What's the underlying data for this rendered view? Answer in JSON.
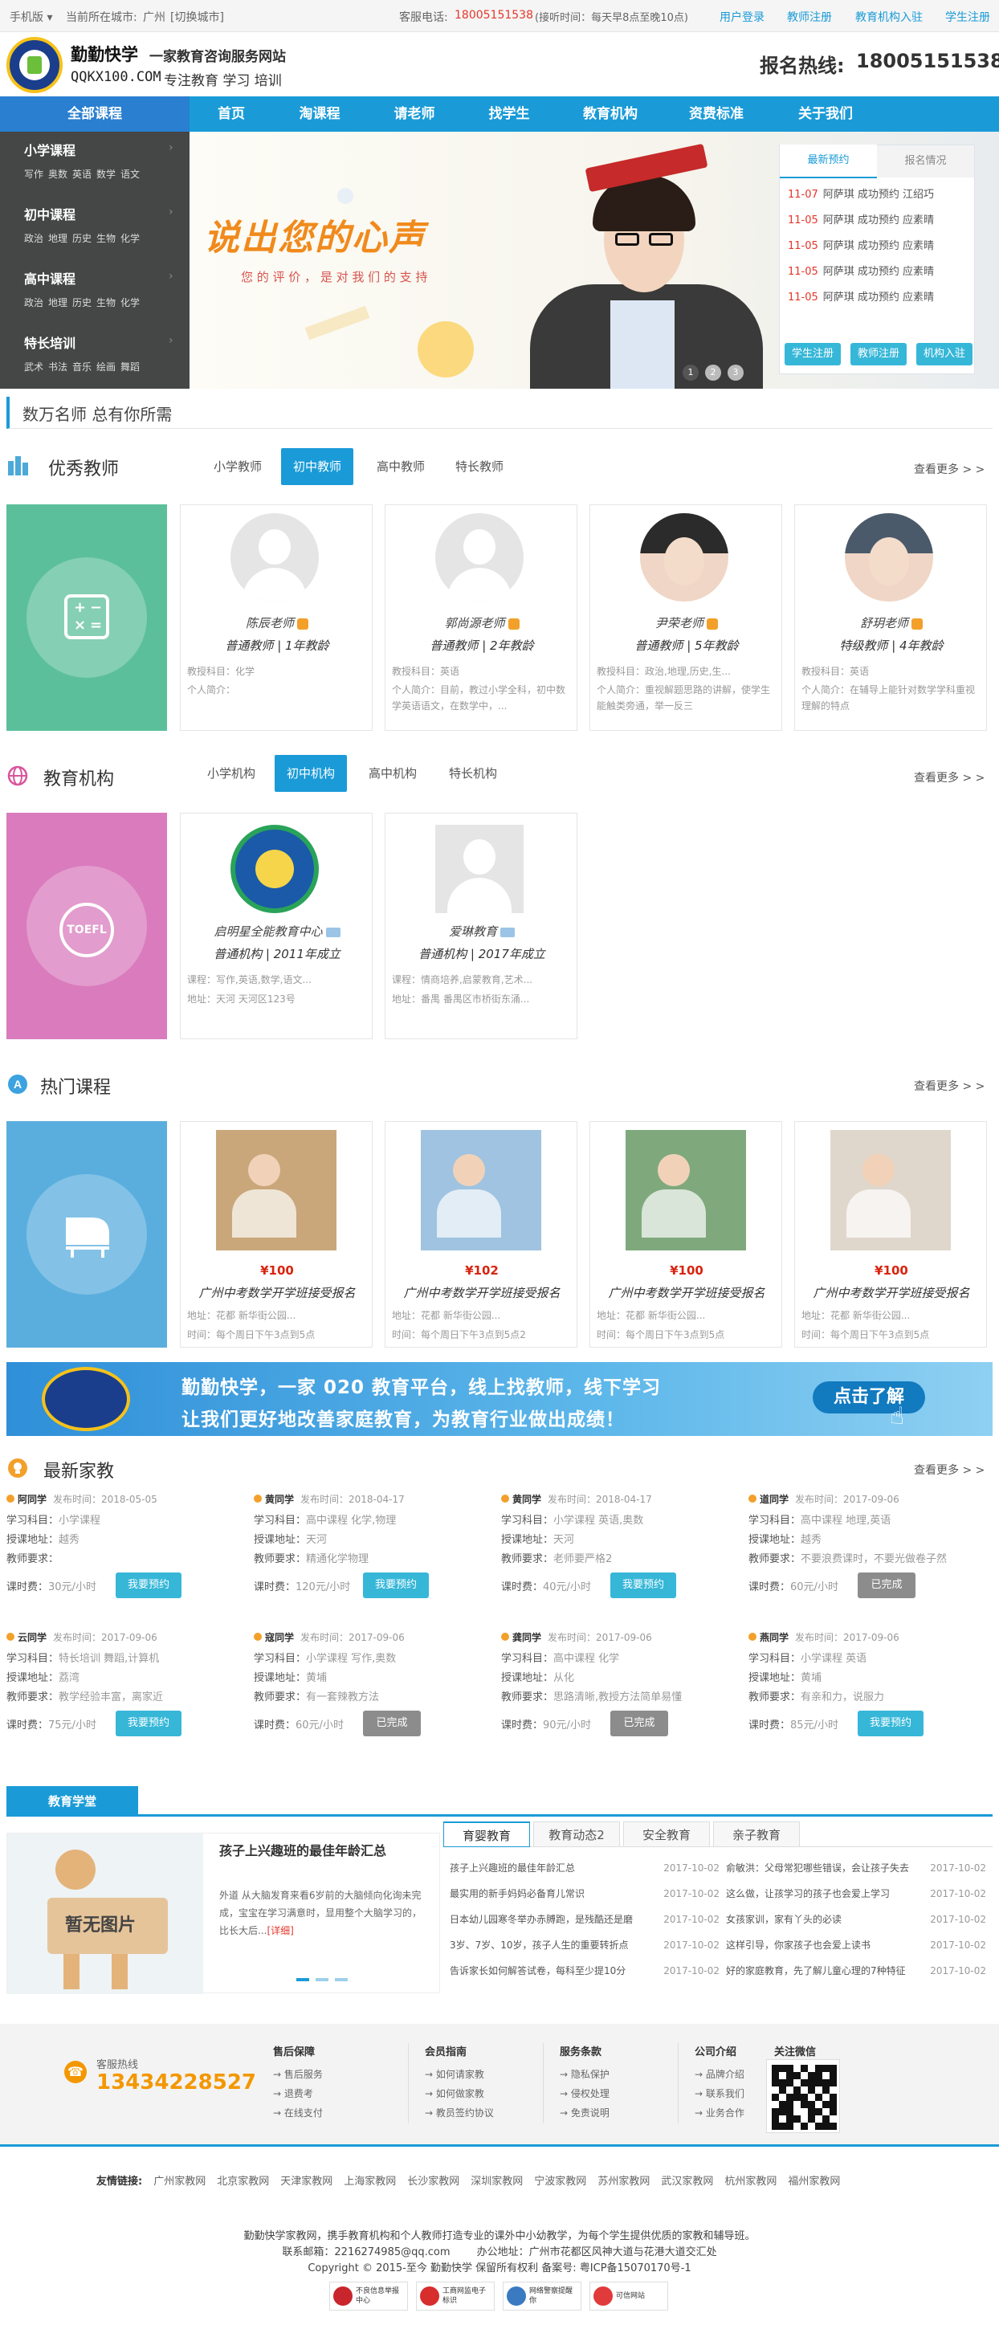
{
  "topbar": {
    "mobile": "手机版",
    "city_label": "当前所在城市:",
    "city": "广州",
    "switch_city": "[切换城市]",
    "hotline_label": "客服电话:",
    "hotline": "18005151538",
    "hours": "(接听时间：每天早8点至晚10点)",
    "login": "用户登录",
    "teacher_reg": "教师注册",
    "org_reg": "教育机构入驻",
    "student_reg": "学生注册"
  },
  "header": {
    "brand": "勤勤快学",
    "slogan1": "一家教育咨询服务网站",
    "domain": "QQKX100.COM",
    "slogan2": "专注教育 学习 培训",
    "hotline_label": "报名热线:",
    "hotline": "18005151538"
  },
  "nav": [
    "全部课程",
    "首页",
    "淘课程",
    "请老师",
    "找学生",
    "教育机构",
    "资费标准",
    "关于我们"
  ],
  "sidebar": [
    {
      "title": "小学课程",
      "subs": [
        "写作",
        "奥数",
        "英语",
        "数学",
        "语文"
      ]
    },
    {
      "title": "初中课程",
      "subs": [
        "政治",
        "地理",
        "历史",
        "生物",
        "化学"
      ]
    },
    {
      "title": "高中课程",
      "subs": [
        "政治",
        "地理",
        "历史",
        "生物",
        "化学"
      ]
    },
    {
      "title": "特长培训",
      "subs": [
        "武术",
        "书法",
        "音乐",
        "绘画",
        "舞蹈"
      ]
    }
  ],
  "banner": {
    "headline": "说出您的心声",
    "sub": "您 的 评 价 ， 是 对 我 们 的 支 持",
    "dots": [
      "1",
      "2",
      "3"
    ]
  },
  "booking_panel": {
    "tabs": [
      "最新预约",
      "报名情况"
    ],
    "items": [
      {
        "date": "11-07",
        "text": "阿萨琪 成功预约 江绍巧"
      },
      {
        "date": "11-05",
        "text": "阿萨琪 成功预约 应素晴"
      },
      {
        "date": "11-05",
        "text": "阿萨琪 成功预约 应素晴"
      },
      {
        "date": "11-05",
        "text": "阿萨琪 成功预约 应素晴"
      },
      {
        "date": "11-05",
        "text": "阿萨琪 成功预约 应素晴"
      }
    ],
    "buttons": [
      "学生注册",
      "教师注册",
      "机构入驻"
    ]
  },
  "tagline": "数万名师 总有你所需",
  "teachers": {
    "title": "优秀教师",
    "tabs": [
      "小学教师",
      "初中教师",
      "高中教师",
      "特长教师"
    ],
    "more": "查看更多 > >",
    "cards": [
      {
        "name": "陈辰老师",
        "level": "普通教师 | 1年教龄",
        "subject_label": "教授科目：",
        "subject": "化学",
        "intro_label": "个人简介：",
        "intro": ""
      },
      {
        "name": "郭尚源老师",
        "level": "普通教师 | 2年教龄",
        "subject_label": "教授科目：",
        "subject": "英语",
        "intro_label": "个人简介：",
        "intro": "目前，教过小学全科，初中数学英语语文，在数学中，..."
      },
      {
        "name": "尹荣老师",
        "level": "普通教师 | 5年教龄",
        "subject_label": "教授科目：",
        "subject": "政治,地理,历史,生...",
        "intro_label": "个人简介：",
        "intro": "重视解题思路的讲解，使学生能触类旁通，举一反三"
      },
      {
        "name": "舒玥老师",
        "level": "特级教师 | 4年教龄",
        "subject_label": "教授科目：",
        "subject": "英语",
        "intro_label": "个人简介：",
        "intro": "在辅导上能针对数学学科重视理解的特点"
      }
    ]
  },
  "orgs": {
    "title": "教育机构",
    "tabs": [
      "小学机构",
      "初中机构",
      "高中机构",
      "特长机构"
    ],
    "more": "查看更多 > >",
    "icon_text": "TOEFL",
    "cards": [
      {
        "name": "启明星全能教育中心",
        "level": "普通机构 | 2011年成立",
        "course_label": "课程：",
        "course": "写作,英语,数学,语文...",
        "addr_label": "地址：",
        "addr": "天河 天河区123号"
      },
      {
        "name": "爱琳教育",
        "level": "普通机构 | 2017年成立",
        "course_label": "课程：",
        "course": "情商培养,启蒙教育,艺术...",
        "addr_label": "地址：",
        "addr": "番禺 番禺区市桥街东涌..."
      }
    ]
  },
  "courses": {
    "title": "热门课程",
    "more": "查看更多 > >",
    "cards": [
      {
        "price": "¥100",
        "name": "广州中考数学开学班接受报名",
        "addr": "地址：花都 新华街公园...",
        "time": "时间：每个周日下午3点到5点"
      },
      {
        "price": "¥102",
        "name": "广州中考数学开学班接受报名",
        "addr": "地址：花都 新华街公园...",
        "time": "时间：每个周日下午3点到5点2"
      },
      {
        "price": "¥100",
        "name": "广州中考数学开学班接受报名",
        "addr": "地址：花都 新华街公园...",
        "time": "时间：每个周日下午3点到5点"
      },
      {
        "price": "¥100",
        "name": "广州中考数学开学班接受报名",
        "addr": "地址：花都 新华街公园...",
        "time": "时间：每个周日下午3点到5点"
      }
    ]
  },
  "ad": {
    "line1": "勤勤快学，一家 020 教育平台，线上找教师，线下学习",
    "line2": "让我们更好地改善家庭教育，为教育行业做出成绩！",
    "button": "点击了解"
  },
  "tutoring": {
    "title": "最新家教",
    "more": "查看更多 > >",
    "labels": {
      "subject": "学习科目：",
      "addr": "授课地址：",
      "req": "教师要求：",
      "fee": "课时费："
    },
    "items": [
      {
        "name": "阿同学",
        "time": "发布时间：2018-05-05",
        "subject": "小学课程",
        "addr": "越秀",
        "req": "",
        "fee": "30元/小时",
        "status": "我要预约",
        "done": false
      },
      {
        "name": "黄同学",
        "time": "发布时间：2018-04-17",
        "subject": "高中课程 化学,物理",
        "addr": "天河",
        "req": "精通化学物理",
        "fee": "120元/小时",
        "status": "我要预约",
        "done": false
      },
      {
        "name": "黄同学",
        "time": "发布时间：2018-04-17",
        "subject": "小学课程 英语,奥数",
        "addr": "天河",
        "req": "老师要严格2",
        "fee": "40元/小时",
        "status": "我要预约",
        "done": false
      },
      {
        "name": "道同学",
        "time": "发布时间：2017-09-06",
        "subject": "高中课程 地理,英语",
        "addr": "越秀",
        "req": "不要浪费课时，不要光做卷子然",
        "fee": "60元/小时",
        "status": "已完成",
        "done": true
      },
      {
        "name": "云同学",
        "time": "发布时间：2017-09-06",
        "subject": "特长培训 舞蹈,计算机",
        "addr": "荔湾",
        "req": "教学经验丰富，离家近",
        "fee": "75元/小时",
        "status": "我要预约",
        "done": false
      },
      {
        "name": "寇同学",
        "time": "发布时间：2017-09-06",
        "subject": "小学课程 写作,奥数",
        "addr": "黄埔",
        "req": "有一套辣教方法",
        "fee": "60元/小时",
        "status": "已完成",
        "done": true
      },
      {
        "name": "龚同学",
        "time": "发布时间：2017-09-06",
        "subject": "高中课程 化学",
        "addr": "从化",
        "req": "思路清晰,教授方法简单易懂",
        "fee": "90元/小时",
        "status": "已完成",
        "done": true
      },
      {
        "name": "燕同学",
        "time": "发布时间：2017-09-06",
        "subject": "小学课程 英语",
        "addr": "黄埔",
        "req": "有亲和力，说服力",
        "fee": "85元/小时",
        "status": "我要预约",
        "done": false
      }
    ]
  },
  "study": {
    "tab": "教育学堂",
    "no_image": "暂无图片",
    "feature_title": "孩子上兴趣班的最佳年龄汇总",
    "feature_text": "外道 从大脑发育来看6岁前的大脑倾向化询未完成，宝宝在学习满意时，显用整个大脑学习的，比长大后...",
    "detail": "[详细]",
    "news_tabs": [
      "育婴教育",
      "教育动态2",
      "安全教育",
      "亲子教育"
    ],
    "news_left": [
      {
        "title": "孩子上兴趣班的最佳年龄汇总",
        "date": "2017-10-02"
      },
      {
        "title": "最实用的新手妈妈必备育儿常识",
        "date": "2017-10-02"
      },
      {
        "title": "日本幼儿园寒冬举办赤膊跑，是残酷还是磨",
        "date": "2017-10-02"
      },
      {
        "title": "3岁、7岁、10岁，孩子人生的重要转折点",
        "date": "2017-10-02"
      },
      {
        "title": "告诉家长如何解答试卷，每科至少提10分",
        "date": "2017-10-02"
      }
    ],
    "news_right": [
      {
        "title": "俞敏洪：父母常犯哪些错误，会让孩子失去",
        "date": "2017-10-02"
      },
      {
        "title": "这么做，让孩学习的孩子也会爱上学习",
        "date": "2017-10-02"
      },
      {
        "title": "女孩家训，家有丫头的必读",
        "date": "2017-10-02"
      },
      {
        "title": "这样引导，你家孩子也会爱上读书",
        "date": "2017-10-02"
      },
      {
        "title": "好的家庭教育，先了解儿童心理的7种特征",
        "date": "2017-10-02"
      }
    ]
  },
  "footer": {
    "hotline_label": "客服热线",
    "hotline": "13434228527",
    "cols": [
      {
        "title": "售后保障",
        "items": [
          "→ 售后服务",
          "→ 退费考",
          "→ 在线支付"
        ]
      },
      {
        "title": "会员指南",
        "items": [
          "→ 如何请家教",
          "→ 如何做家教",
          "→ 教员签约协议"
        ]
      },
      {
        "title": "服务条款",
        "items": [
          "→ 隐私保护",
          "→ 侵权处理",
          "→ 免责说明"
        ]
      },
      {
        "title": "公司介绍",
        "items": [
          "→ 品牌介绍",
          "→ 联系我们",
          "→ 业务合作"
        ]
      }
    ],
    "wechat": "关注微信",
    "links_label": "友情链接:",
    "links": [
      "广州家教网",
      "北京家教网",
      "天津家教网",
      "上海家教网",
      "长沙家教网",
      "深圳家教网",
      "宁波家教网",
      "苏州家教网",
      "武汉家教网",
      "杭州家教网",
      "福州家教网"
    ],
    "desc": "勤勤快学家教网，携手教育机构和个人教师打造专业的课外中小幼教学，为每个学生提供优质的家教和辅导班。",
    "contact": "联系邮箱：2216274985@qq.com        办公地址：广州市花都区风神大道与花港大道交汇处",
    "copyright": "Copyright © 2015-至今 勤勤快学 保留所有权利 备案号: 粤ICP备15070170号-1",
    "badges": [
      "不良信息举报中心",
      "工商网监电子标识",
      "网络警察提醒你",
      "可信网站"
    ]
  },
  "colors": {
    "primary": "#1a9bd7",
    "teacher_tile": "#5cbf9c",
    "org_tile": "#d97bbd",
    "course_tile": "#5aaede",
    "hotline_orange": "#f39700"
  }
}
